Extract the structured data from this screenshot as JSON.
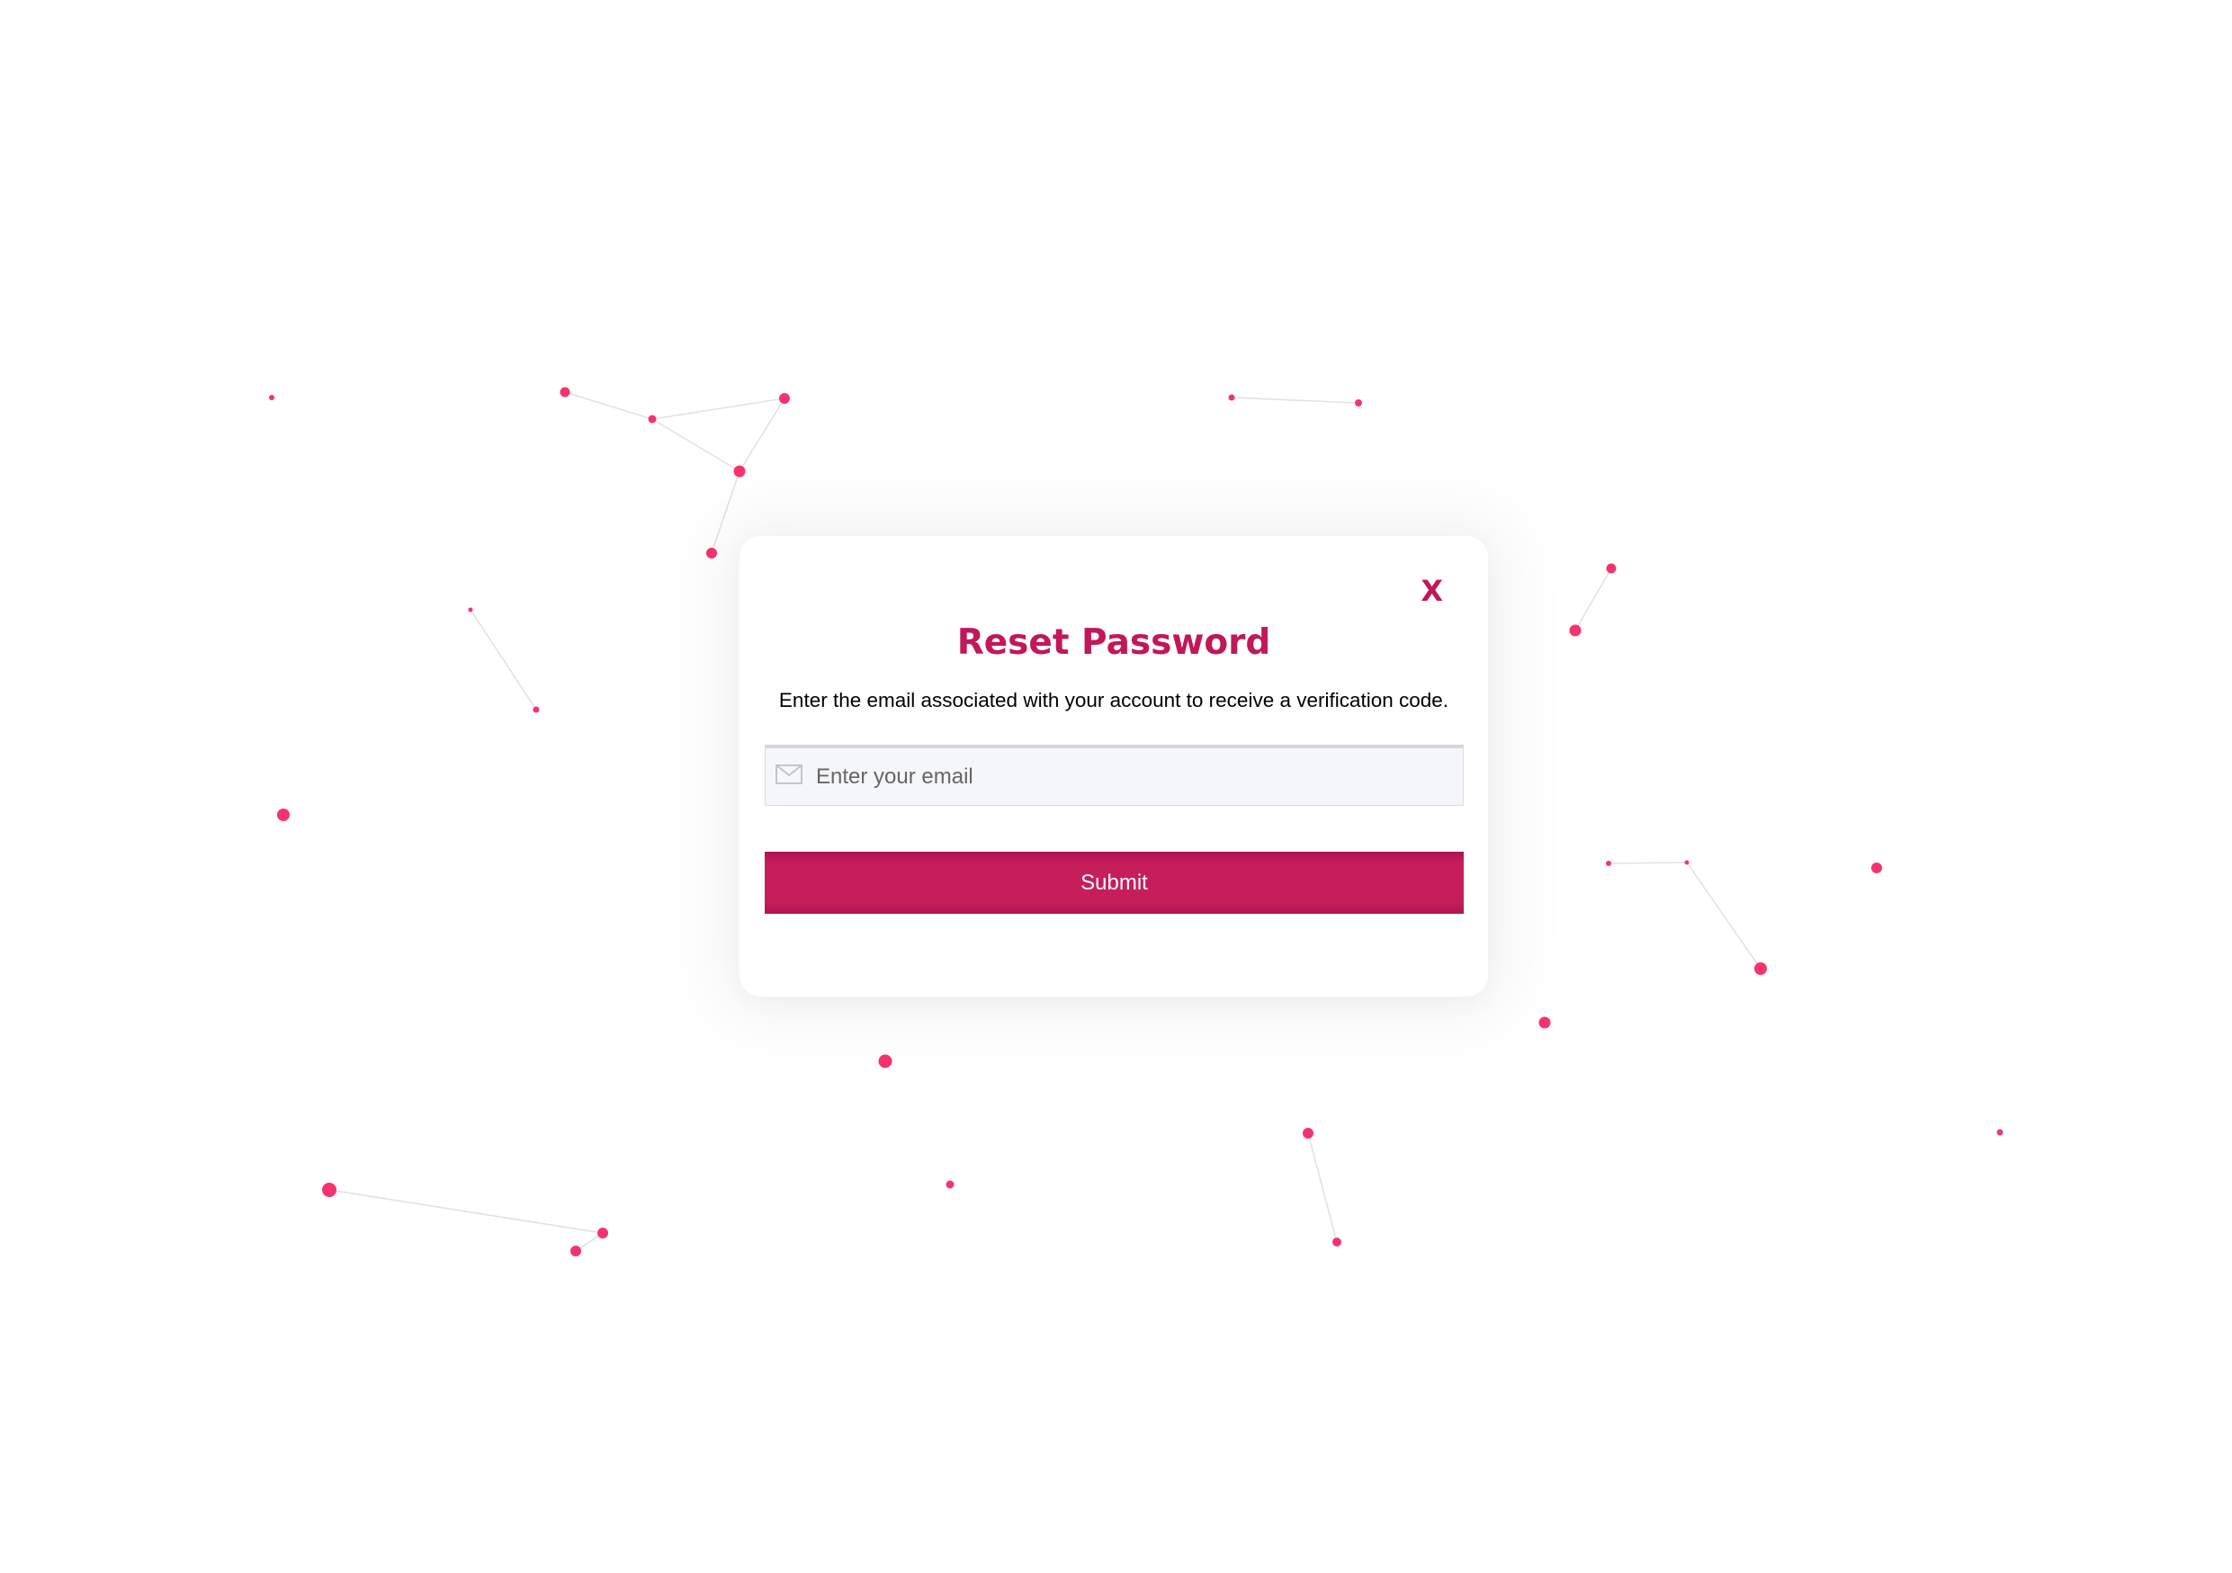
{
  "modal": {
    "close_label": "X",
    "title": "Reset Password",
    "description": "Enter the email associated with your account to receive a verification code.",
    "email": {
      "value": "",
      "placeholder": "Enter your email",
      "icon": "mail-icon"
    },
    "submit_label": "Submit"
  },
  "background": {
    "style": "connected particles",
    "particle_color": "#f5336f",
    "link_color": "#e2e2e6"
  },
  "colors": {
    "accent": "#c0185a",
    "page_background": "#ffffff",
    "field_background": "#f5f6f9"
  }
}
